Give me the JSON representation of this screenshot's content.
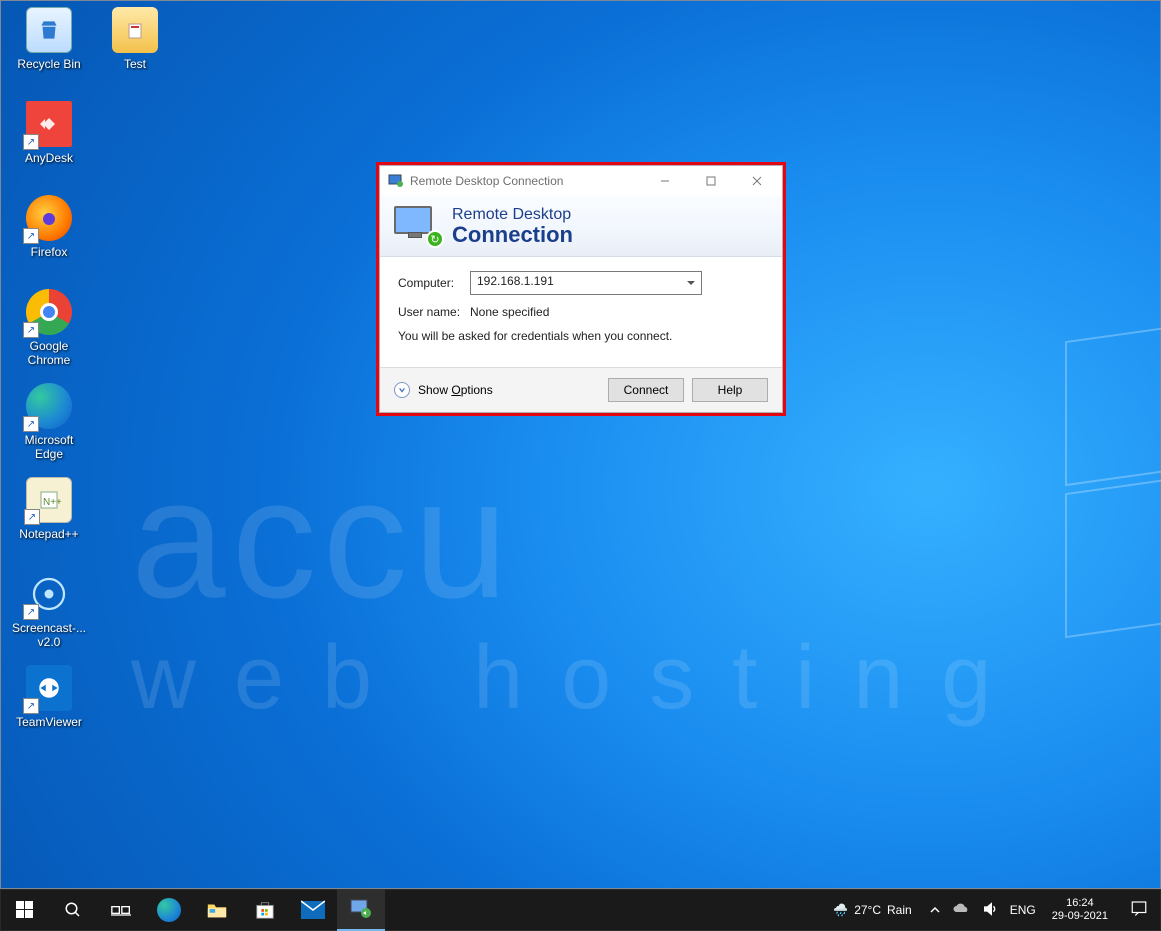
{
  "desktop_icons": [
    {
      "label": "Recycle Bin",
      "kind": "recycle"
    },
    {
      "label": "Test",
      "kind": "folder"
    },
    {
      "label": "AnyDesk",
      "kind": "anydesk"
    },
    {
      "label": "Firefox",
      "kind": "firefox"
    },
    {
      "label": "Google Chrome",
      "kind": "chrome"
    },
    {
      "label": "Microsoft Edge",
      "kind": "edge"
    },
    {
      "label": "Notepad++",
      "kind": "npp"
    },
    {
      "label": "Screencast-... v2.0",
      "kind": "screencast"
    },
    {
      "label": "TeamViewer",
      "kind": "teamviewer"
    }
  ],
  "dialog": {
    "title": "Remote Desktop Connection",
    "heading_line1": "Remote Desktop",
    "heading_line2": "Connection",
    "computer_label": "Computer:",
    "computer_value": "192.168.1.191",
    "username_label": "User name:",
    "username_value": "None specified",
    "note": "You will be asked for credentials when you connect.",
    "show_options": "Show Options",
    "connect": "Connect",
    "help": "Help"
  },
  "taskbar": {
    "weather_temp": "27°C",
    "weather_cond": "Rain",
    "lang": "ENG",
    "time": "16:24",
    "date": "29-09-2021"
  },
  "watermark_line1": "accu",
  "watermark_line2": "web hosting"
}
